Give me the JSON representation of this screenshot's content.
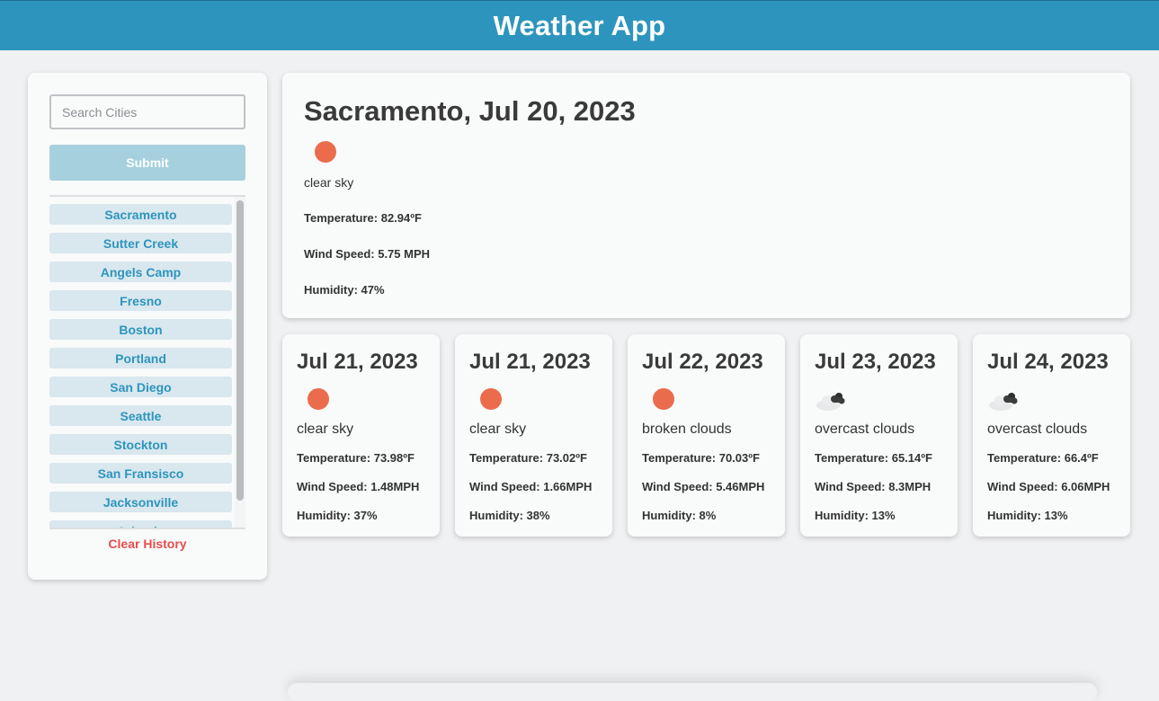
{
  "header": {
    "title": "Weather App"
  },
  "sidebar": {
    "search_placeholder": "Search Cities",
    "submit_label": "Submit",
    "history": [
      "Sacramento",
      "Sutter Creek",
      "Angels Camp",
      "Fresno",
      "Boston",
      "Portland",
      "San Diego",
      "Seattle",
      "Stockton",
      "San Fransisco",
      "Jacksonville",
      "Orlando"
    ],
    "clear_label": "Clear History"
  },
  "current": {
    "title": "Sacramento, Jul 20, 2023",
    "icon": "sun-icon",
    "description": "clear sky",
    "temperature": "Temperature: 82.94ºF",
    "wind": "Wind Speed: 5.75 MPH",
    "humidity": "Humidity: 47%"
  },
  "forecast": [
    {
      "date": "Jul 21, 2023",
      "icon": "sun-icon",
      "description": "clear sky",
      "temperature": "Temperature: 73.98ºF",
      "wind": "Wind Speed: 1.48MPH",
      "humidity": "Humidity: 37%"
    },
    {
      "date": "Jul 21, 2023",
      "icon": "sun-icon",
      "description": "clear sky",
      "temperature": "Temperature: 73.02ºF",
      "wind": "Wind Speed: 1.66MPH",
      "humidity": "Humidity: 38%"
    },
    {
      "date": "Jul 22, 2023",
      "icon": "sun-icon",
      "description": "broken clouds",
      "temperature": "Temperature: 70.03ºF",
      "wind": "Wind Speed: 5.46MPH",
      "humidity": "Humidity: 8%"
    },
    {
      "date": "Jul 23, 2023",
      "icon": "overcast-cloud-icon",
      "description": "overcast clouds",
      "temperature": "Temperature: 65.14ºF",
      "wind": "Wind Speed: 8.3MPH",
      "humidity": "Humidity: 13%"
    },
    {
      "date": "Jul 24, 2023",
      "icon": "overcast-cloud-icon",
      "description": "overcast clouds",
      "temperature": "Temperature: 66.4ºF",
      "wind": "Wind Speed: 6.06MPH",
      "humidity": "Humidity: 13%"
    }
  ],
  "colors": {
    "header": "#2d95bd",
    "sun": "#ea6c4d",
    "history_text": "#2d95bd",
    "clear_text": "#e84c4c"
  }
}
